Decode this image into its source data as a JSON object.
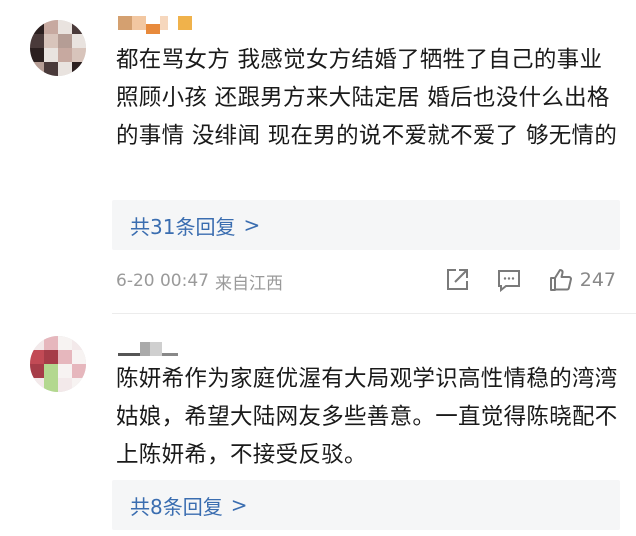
{
  "comments": [
    {
      "text": "都在骂女方 我感觉女方结婚了牺牲了自己的事业 照顾小孩 还跟男方来大陆定居 婚后也没什么出格的事情 没绯闻 现在男的说不爱就不爱了 够无情的",
      "reply_label": "共31条回复",
      "reply_chevron": ">",
      "timestamp": "6-20 00:47",
      "location": "来自江西",
      "like_count": "247",
      "icons": [
        "share-icon",
        "comment-icon",
        "like-icon"
      ]
    },
    {
      "text": "陈妍希作为家庭优渥有大局观学识高性情稳的湾湾姑娘，希望大陆网友多些善意。一直觉得陈晓配不上陈妍希，不接受反驳。",
      "reply_label": "共8条回复",
      "reply_chevron": ">"
    }
  ],
  "colors": {
    "link": "#3a6db0",
    "meta": "#9a9a9a",
    "reply_bg": "#f5f6f7",
    "avatar1_pixels": [
      "#2b1f1f",
      "#c7a9a0",
      "#e9e3df",
      "#4a3a3a",
      "#d8c4bb",
      "#b59d95"
    ],
    "avatar2_pixels": [
      "#c24a55",
      "#e6b7bd",
      "#f3e9ea",
      "#b3d88f",
      "#f7f3f2",
      "#a63c48"
    ],
    "username1_pixels": [
      "#d4a070",
      "#f2c7a1",
      "#e88a3c",
      "#f6d7bd",
      "#f0b24b"
    ],
    "username2_pixels": [
      "#555555",
      "#aaaaaa",
      "#cfcfcf",
      "#888888"
    ]
  }
}
